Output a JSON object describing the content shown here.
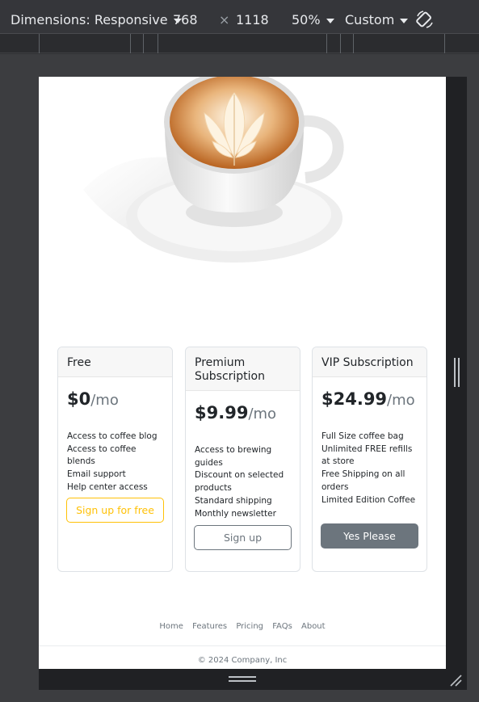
{
  "devtools": {
    "dimensions_label": "Dimensions: Responsive",
    "width": "768",
    "times": "×",
    "height": "1118",
    "zoom": "50%",
    "throttle": "Custom"
  },
  "plans": [
    {
      "name": "Free",
      "price": "$0",
      "per": "/mo",
      "features": [
        "Access to coffee blog",
        "Access to coffee blends",
        "Email support",
        "Help center access"
      ],
      "button": "Sign up for free"
    },
    {
      "name": "Premium Subscription",
      "price": "$9.99",
      "per": "/mo",
      "features": [
        "Access to brewing guides",
        "Discount on selected products",
        "Standard shipping",
        "Monthly newsletter"
      ],
      "button": "Sign up"
    },
    {
      "name": "VIP Subscription",
      "price": "$24.99",
      "per": "/mo",
      "features": [
        "Full Size coffee bag",
        "Unlimited FREE refills at store",
        "Free Shipping on all orders",
        "Limited Edition Coffee"
      ],
      "button": "Yes Please"
    }
  ],
  "footer": {
    "nav": [
      "Home",
      "Features",
      "Pricing",
      "FAQs",
      "About"
    ],
    "copyright": "© 2024 Company, Inc"
  },
  "colors": {
    "free_button": "#ffc107",
    "secondary": "#6c757d",
    "coffee": "#c9762f",
    "foam": "#fdf3e1"
  }
}
